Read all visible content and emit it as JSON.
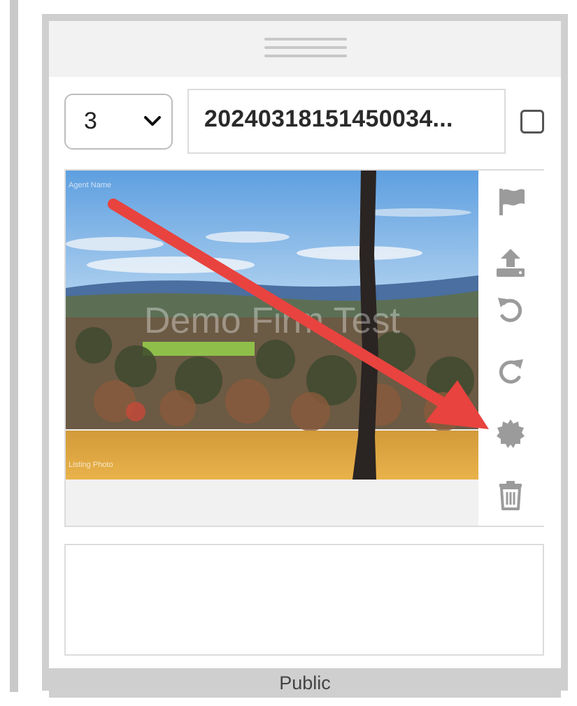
{
  "photo_card": {
    "order_select": {
      "value": "3"
    },
    "filename": "20240318151450034...",
    "selected": false,
    "photo": {
      "watermark_text": "Demo Firm Test",
      "corner_text_top": "Agent Name",
      "corner_text_bottom": "Listing Photo"
    },
    "tools": [
      {
        "icon": "flag-icon"
      },
      {
        "icon": "upload-icon"
      },
      {
        "icon": "rotate-left-icon"
      },
      {
        "icon": "rotate-right-icon"
      },
      {
        "icon": "badge-icon"
      },
      {
        "icon": "trash-icon"
      }
    ],
    "caption": "",
    "visibility_label": "Public"
  },
  "colors": {
    "annotation_arrow": "#e8433f",
    "icon_gray": "#9b9b9b",
    "border_gray": "#cfcfcf"
  }
}
